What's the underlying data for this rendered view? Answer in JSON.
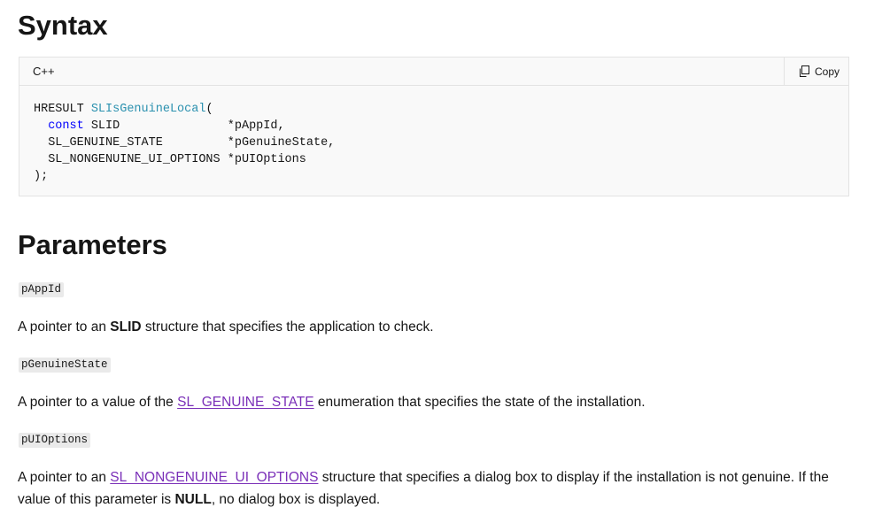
{
  "syntax": {
    "heading": "Syntax",
    "lang": "C++",
    "copy_label": "Copy",
    "code": {
      "ret_type": "HRESULT",
      "func_name": "SLIsGenuineLocal",
      "open": "(",
      "kw_const": "const",
      "line1_type": "SLID",
      "line1_param": "*pAppId,",
      "line2_type": "SL_GENUINE_STATE",
      "line2_param": "*pGenuineState,",
      "line3_type": "SL_NONGENUINE_UI_OPTIONS",
      "line3_param": "*pUIOptions",
      "close": ");"
    }
  },
  "parameters": {
    "heading": "Parameters",
    "items": [
      {
        "name": "pAppId",
        "pre": "A pointer to an ",
        "bold": "SLID",
        "post": " structure that specifies the application to check."
      },
      {
        "name": "pGenuineState",
        "pre": "A pointer to a value of the ",
        "link": "SL_GENUINE_STATE",
        "post": " enumeration that specifies the state of the installation."
      },
      {
        "name": "pUIOptions",
        "pre": "A pointer to an ",
        "link": "SL_NONGENUINE_UI_OPTIONS",
        "mid": " structure that specifies a dialog box to display if the installation is not genuine. If the value of this parameter is ",
        "bold": "NULL",
        "post": ", no dialog box is displayed."
      }
    ]
  },
  "colors": {
    "keyword": "#0101fd",
    "function": "#2b91af",
    "link": "#7a2fb8"
  }
}
